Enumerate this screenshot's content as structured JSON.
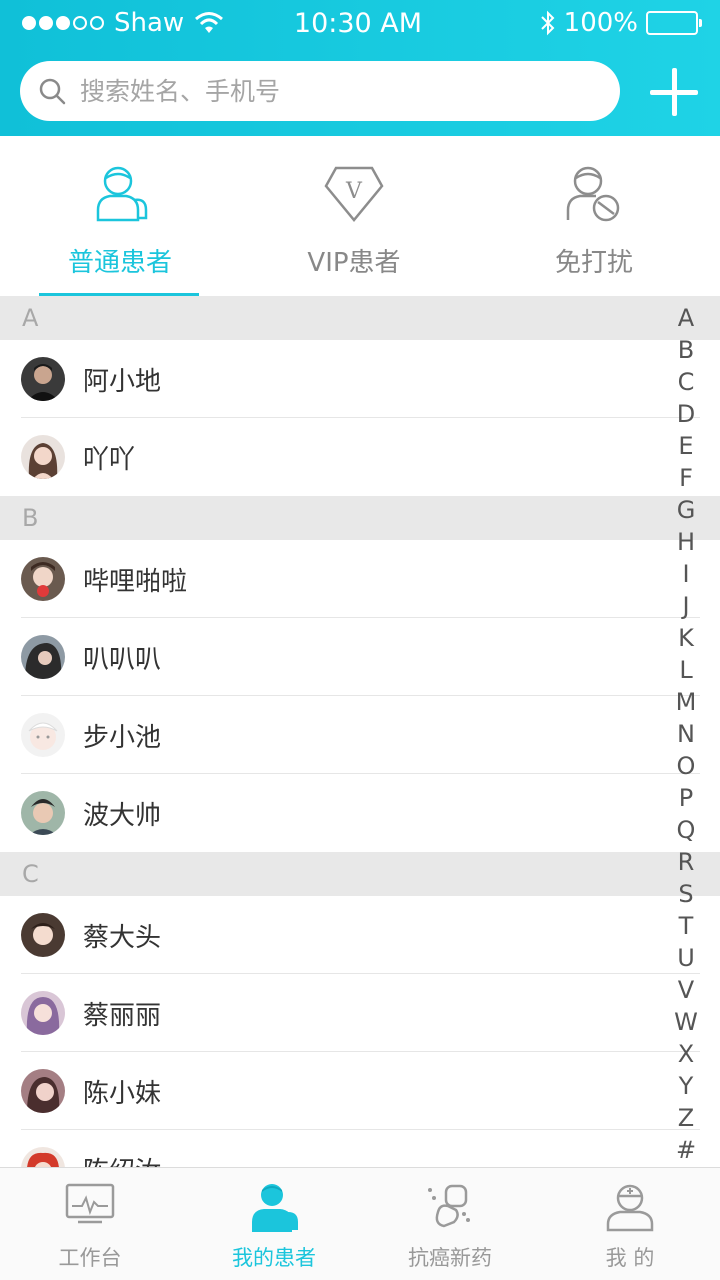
{
  "status_bar": {
    "carrier": "Shaw",
    "time": "10:30 AM",
    "battery": "100%",
    "signal_bars": 3
  },
  "search": {
    "placeholder": "搜索姓名、手机号"
  },
  "tabs": [
    {
      "label": "普通患者",
      "icon": "person-icon",
      "active": true
    },
    {
      "label": "VIP患者",
      "icon": "vip-diamond-icon",
      "active": false
    },
    {
      "label": "免打扰",
      "icon": "do-not-disturb-person-icon",
      "active": false
    }
  ],
  "sections": [
    {
      "letter": "A",
      "contacts": [
        {
          "name": "阿小地"
        },
        {
          "name": "吖吖"
        }
      ]
    },
    {
      "letter": "B",
      "contacts": [
        {
          "name": "哔哩啪啦"
        },
        {
          "name": "叭叭叭"
        },
        {
          "name": "步小池"
        },
        {
          "name": "波大帅"
        }
      ]
    },
    {
      "letter": "C",
      "contacts": [
        {
          "name": "蔡大头"
        },
        {
          "name": "蔡丽丽"
        },
        {
          "name": "陈小妹"
        },
        {
          "name": "陈绍汝"
        }
      ]
    }
  ],
  "index_letters": [
    "A",
    "B",
    "C",
    "D",
    "E",
    "F",
    "G",
    "H",
    "I",
    "J",
    "K",
    "L",
    "M",
    "N",
    "O",
    "P",
    "Q",
    "R",
    "S",
    "T",
    "U",
    "V",
    "W",
    "X",
    "Y",
    "Z",
    "#"
  ],
  "tab_bar": [
    {
      "label": "工作台",
      "icon": "monitor-icon",
      "active": false
    },
    {
      "label": "我的患者",
      "icon": "patients-icon",
      "active": true
    },
    {
      "label": "抗癌新药",
      "icon": "medicine-icon",
      "active": false
    },
    {
      "label": "我 的",
      "icon": "doctor-icon",
      "active": false
    }
  ],
  "colors": {
    "accent": "#1bc5dc",
    "header_start": "#10c0d8",
    "header_end": "#1fd3e6",
    "section_bg": "#e8e8e8"
  }
}
